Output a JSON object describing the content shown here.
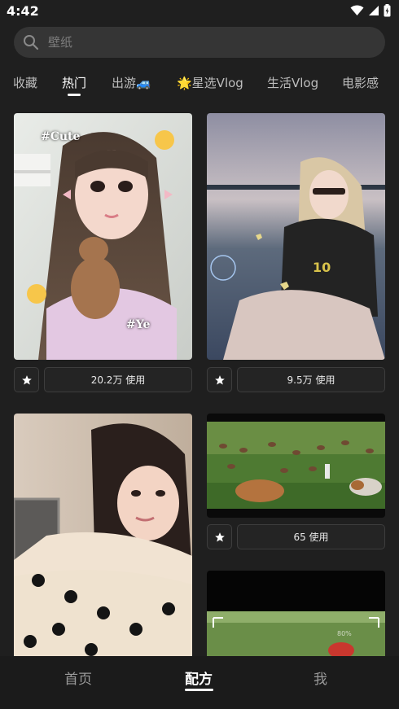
{
  "status_bar": {
    "time": "4:42"
  },
  "search": {
    "placeholder": "壁纸"
  },
  "tabs": [
    {
      "label": "收藏"
    },
    {
      "label": "热门"
    },
    {
      "label": "出游🚙"
    },
    {
      "label": "🌟星选Vlog"
    },
    {
      "label": "生活Vlog"
    },
    {
      "label": "电影感"
    }
  ],
  "active_tab": "热门",
  "templates": [
    {
      "sticker_top": "#Cute",
      "sticker_bottom": "#Ye",
      "usage": "20.2万 使用"
    },
    {
      "usage": "9.5万 使用"
    },
    {
      "usage": ""
    },
    {
      "usage": "65 使用"
    },
    {
      "usage": ""
    }
  ],
  "photo_overlay": {
    "percent": "80%"
  },
  "bottom_nav": [
    {
      "label": "首页"
    },
    {
      "label": "配方"
    },
    {
      "label": "我"
    }
  ],
  "active_nav": "配方",
  "colors": {
    "background": "#1f1f1f",
    "search_bg": "#353535",
    "button_border": "#3d3d3d",
    "active": "#ffffff",
    "inactive": "#bdbdbd"
  }
}
